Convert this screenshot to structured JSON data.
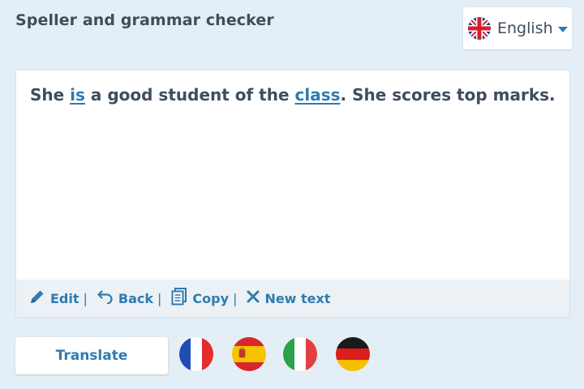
{
  "header": {
    "title": "Speller and grammar checker"
  },
  "language_selector": {
    "selected": "English",
    "flag_icon": "uk-flag-icon",
    "caret_icon": "caret-down-icon"
  },
  "editor": {
    "segments": [
      {
        "text": "She ",
        "flagged": false
      },
      {
        "text": "is",
        "flagged": true
      },
      {
        "text": " a good student of the ",
        "flagged": false
      },
      {
        "text": "class",
        "flagged": true
      },
      {
        "text": ". She scores top marks.",
        "flagged": false
      }
    ]
  },
  "toolbar": {
    "edit": {
      "label": "Edit",
      "icon": "pencil-icon"
    },
    "back": {
      "label": "Back",
      "icon": "undo-arrow-icon"
    },
    "copy": {
      "label": "Copy",
      "icon": "copy-icon"
    },
    "new_text": {
      "label": "New text",
      "icon": "x-icon"
    },
    "separator": "|"
  },
  "translate_button": {
    "label": "Translate"
  },
  "translate_flags": [
    {
      "name": "france-flag-icon",
      "colors": [
        "#1f4bb5",
        "#ffffff",
        "#e52b2b"
      ]
    },
    {
      "name": "spain-flag-icon",
      "colors": [
        "#d9262a",
        "#f7c300",
        "#d9262a"
      ]
    },
    {
      "name": "italy-flag-icon",
      "colors": [
        "#2aa24a",
        "#ffffff",
        "#e04040"
      ]
    },
    {
      "name": "germany-flag-icon",
      "colors": [
        "#1a1a1a",
        "#dd1c1c",
        "#f6c000"
      ]
    }
  ],
  "colors": {
    "background": "#e4eef6",
    "accent": "#2f7bb0",
    "text": "#3f4d5e"
  }
}
